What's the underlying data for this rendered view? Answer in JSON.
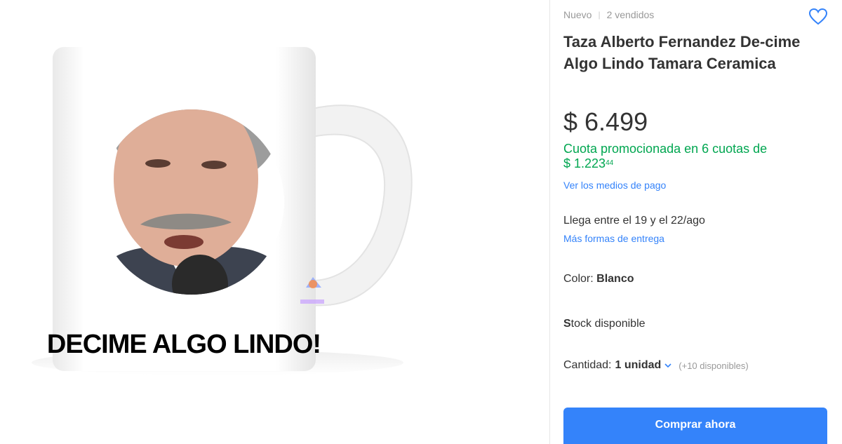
{
  "product": {
    "condition": "Nuevo",
    "separator": "|",
    "sold": "2 vendidos",
    "title": "Taza Alberto Fernandez De-cime Algo Lindo Tamara Ceramica",
    "mug_caption": "DECIME ALGO LINDO!",
    "image_icon": "product-photo"
  },
  "price": {
    "currency": "$",
    "amount": "6.499"
  },
  "installments": {
    "text": "Cuota promocionada en 6 cuotas de",
    "amount": "$ 1.223",
    "cents": "44"
  },
  "links": {
    "payment_methods": "Ver los medios de pago",
    "delivery_options": "Más formas de entrega"
  },
  "delivery": {
    "text": "Llega entre el 19 y el 22/ago"
  },
  "variant": {
    "label": "Color:",
    "value": "Blanco"
  },
  "stock": {
    "first_letter": "S",
    "rest": "tock disponible"
  },
  "quantity": {
    "label": "Cantidad:",
    "value": "1 unidad",
    "available": "(+10 disponibles)"
  },
  "actions": {
    "buy_now": "Comprar ahora",
    "favorite_icon": "heart-icon"
  },
  "colors": {
    "accent": "#3483fa",
    "success": "#00a650",
    "text": "#333333",
    "muted": "#999999"
  }
}
